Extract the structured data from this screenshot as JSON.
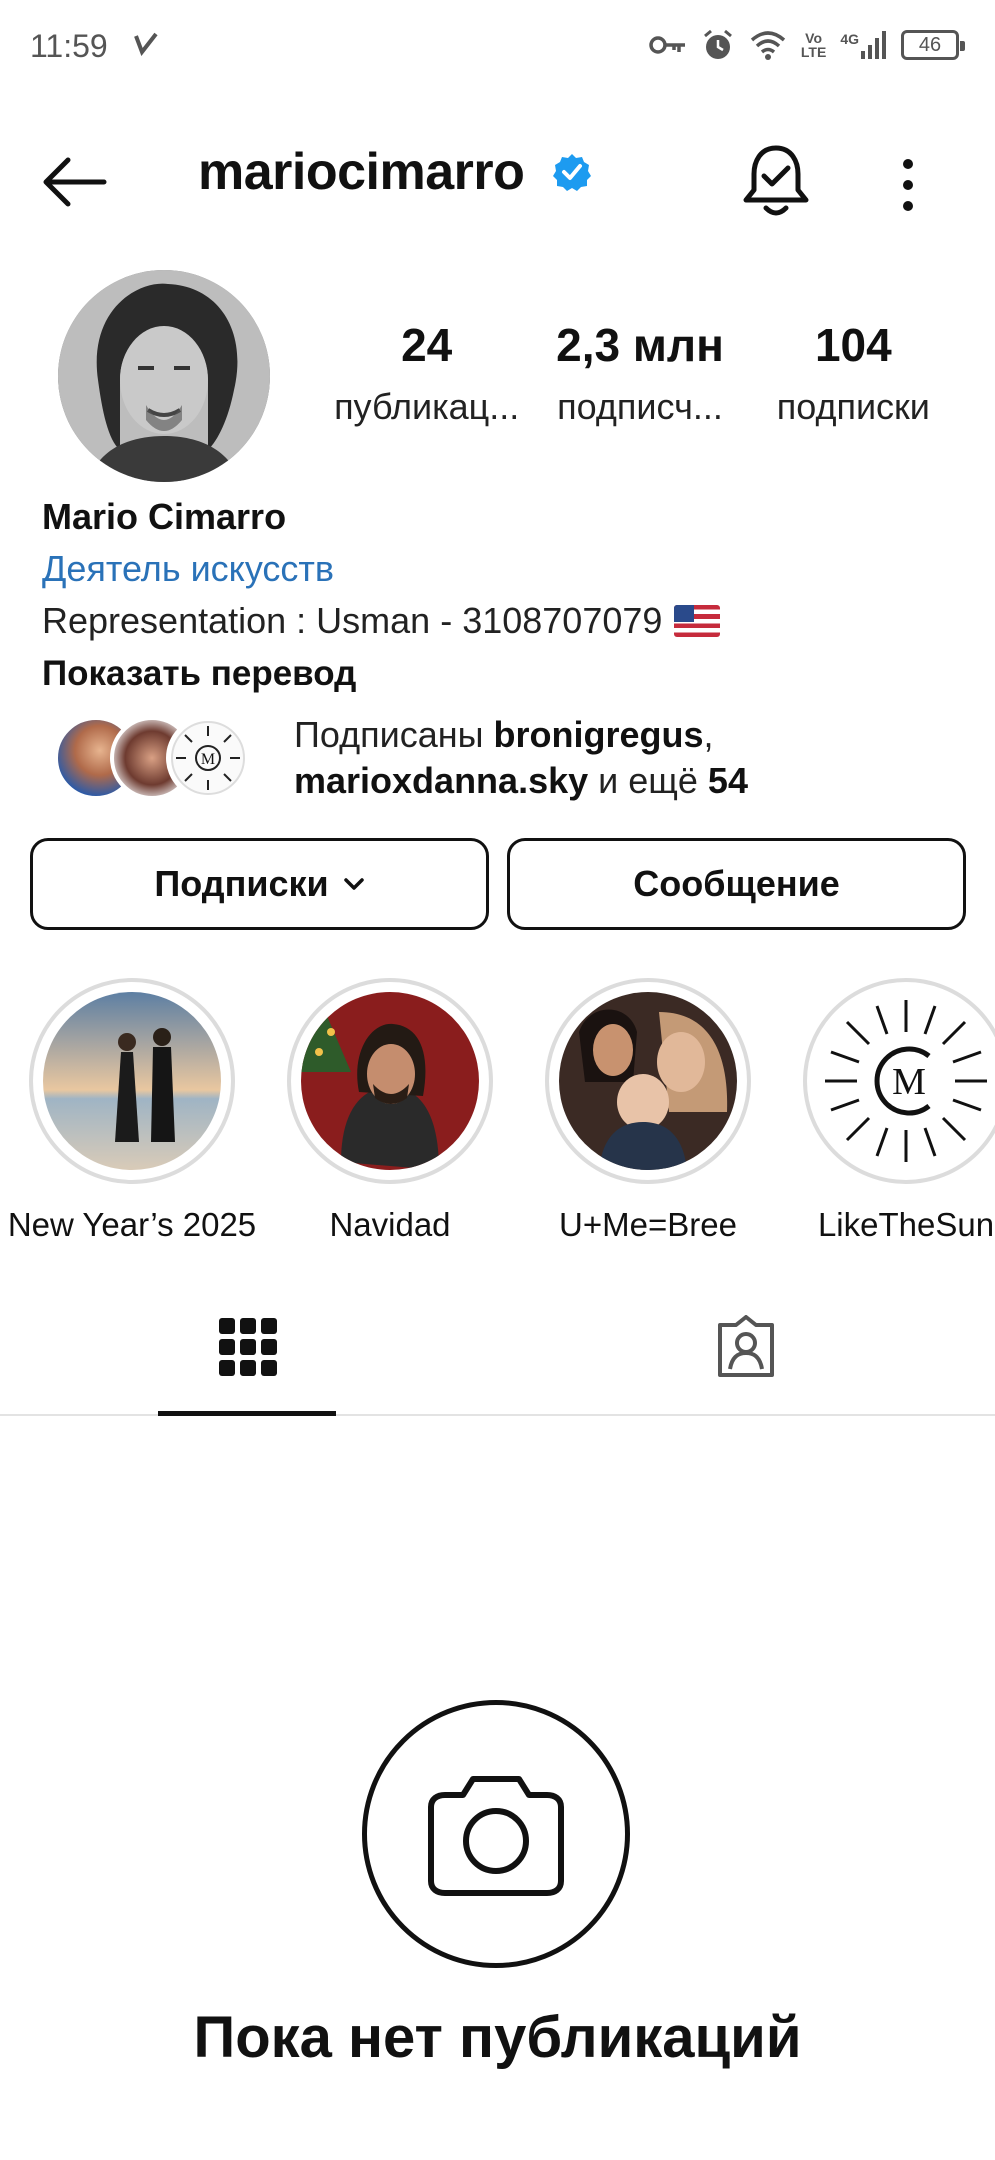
{
  "status_bar": {
    "time": "11:59",
    "network_top": "Vo",
    "network_bottom": "LTE",
    "signal_label": "4G",
    "battery": "46"
  },
  "header": {
    "username": "mariocimarro",
    "verified_color": "#1d9bf0"
  },
  "profile": {
    "stats": [
      {
        "value": "24",
        "label": "публикац..."
      },
      {
        "value": "2,3 млн",
        "label": "подписч..."
      },
      {
        "value": "104",
        "label": "подписки"
      }
    ],
    "full_name": "Mario Cimarro",
    "category": "Деятель искусств",
    "bio": "Representation : Usman - 3108707079",
    "translate": "Показать перевод",
    "mutual": {
      "prefix": "Подписаны ",
      "user1": "bronigregus",
      "sep": ",",
      "user2": "marioxdanna.sky",
      "middle": " и ещё ",
      "count": "54"
    }
  },
  "buttons": {
    "following": "Подписки",
    "message": "Сообщение"
  },
  "highlights": [
    {
      "label": "New Year’s 2025"
    },
    {
      "label": "Navidad"
    },
    {
      "label": "U+Me=Bree"
    },
    {
      "label": "LikeTheSun"
    }
  ],
  "tabs": [
    "posts-grid",
    "tagged"
  ],
  "empty_state": {
    "title": "Пока нет публикаций"
  },
  "colors": {
    "category_link": "#2a72b8",
    "verified": "#1d9bf0"
  }
}
